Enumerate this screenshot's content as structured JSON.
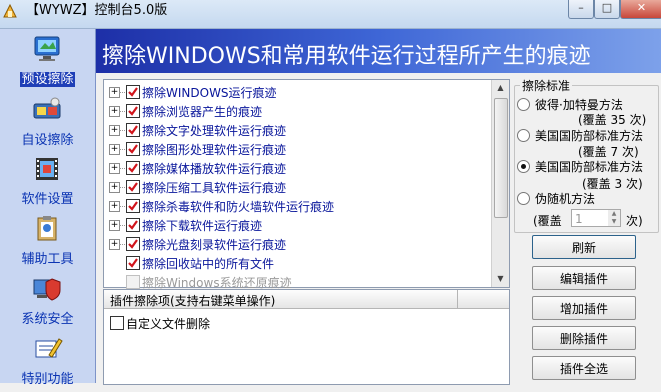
{
  "window": {
    "title": "【WYWZ】控制台5.0版",
    "controls": {
      "minimize": "–",
      "maximize": "□",
      "close": "✕"
    }
  },
  "sidebar": {
    "items": [
      {
        "label": "预设擦除",
        "icon": "monitor-icon",
        "active": true
      },
      {
        "label": "自设擦除",
        "icon": "eraser-icon",
        "active": false
      },
      {
        "label": "软件设置",
        "icon": "film-icon",
        "active": false
      },
      {
        "label": "辅助工具",
        "icon": "clipboard-icon",
        "active": false
      },
      {
        "label": "系统安全",
        "icon": "shield-computer-icon",
        "active": false
      },
      {
        "label": "特别功能",
        "icon": "pencil-notebook-icon",
        "active": false
      }
    ]
  },
  "banner": {
    "title": "擦除WINDOWS和常用软件运行过程所产生的痕迹"
  },
  "tree": {
    "items": [
      {
        "label": "擦除WINDOWS运行痕迹",
        "checked": true,
        "expandable": true,
        "enabled": true
      },
      {
        "label": "擦除浏览器产生的痕迹",
        "checked": true,
        "expandable": true,
        "enabled": true
      },
      {
        "label": "擦除文字处理软件运行痕迹",
        "checked": true,
        "expandable": true,
        "enabled": true
      },
      {
        "label": "擦除图形处理软件运行痕迹",
        "checked": true,
        "expandable": true,
        "enabled": true
      },
      {
        "label": "擦除媒体播放软件运行痕迹",
        "checked": true,
        "expandable": true,
        "enabled": true
      },
      {
        "label": "擦除压缩工具软件运行痕迹",
        "checked": true,
        "expandable": true,
        "enabled": true
      },
      {
        "label": "擦除杀毒软件和防火墙软件运行痕迹",
        "checked": true,
        "expandable": true,
        "enabled": true
      },
      {
        "label": "擦除下载软件运行痕迹",
        "checked": true,
        "expandable": true,
        "enabled": true
      },
      {
        "label": "擦除光盘刻录软件运行痕迹",
        "checked": true,
        "expandable": true,
        "enabled": true
      },
      {
        "label": "擦除回收站中的所有文件",
        "checked": true,
        "expandable": false,
        "enabled": true
      },
      {
        "label": "擦除Windows系统还原痕迹",
        "checked": false,
        "expandable": false,
        "enabled": false
      }
    ]
  },
  "plugins": {
    "header": "插件擦除项(支持右键菜单操作)",
    "items": [
      {
        "label": "自定义文件删除",
        "checked": false
      }
    ]
  },
  "criteria": {
    "legend": "擦除标准",
    "options": [
      {
        "label": "彼得·加特曼方法",
        "cover": "(覆盖 35 次)",
        "selected": false
      },
      {
        "label": "美国国防部标准方法",
        "cover": "(覆盖 7 次)",
        "selected": false
      },
      {
        "label": "美国国防部标准方法",
        "cover": "(覆盖 3 次)",
        "selected": true
      },
      {
        "label": "伪随机方法",
        "cover": "",
        "selected": false
      }
    ],
    "custom_prefix": "(覆盖",
    "custom_value": "1",
    "custom_suffix": "次)"
  },
  "buttons": {
    "refresh": "刷新",
    "edit_plugin": "编辑插件",
    "add_plugin": "增加插件",
    "delete_plugin": "删除插件",
    "select_all_plugins": "插件全选"
  },
  "colors": {
    "banner_start": "#1d2fa7",
    "banner_end": "#7da1ea",
    "tree_text": "#08159a",
    "sidebar_bg": "#c8d6f2",
    "sidebar_text": "#0b34b3",
    "active_highlight": "#1f3fb7",
    "check_red": "#d1141b"
  }
}
